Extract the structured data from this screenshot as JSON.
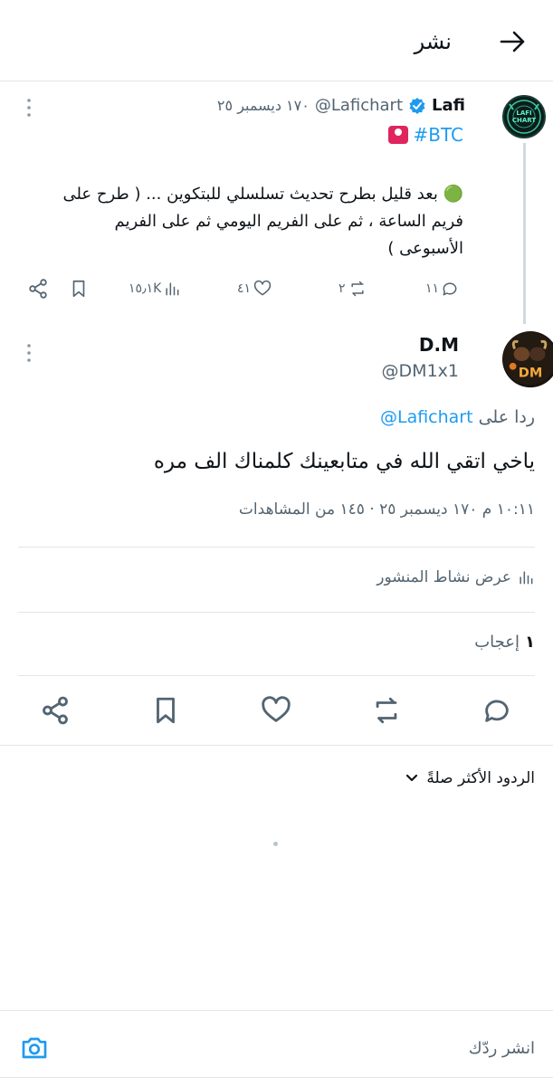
{
  "header": {
    "title": "نشر"
  },
  "parent_tweet": {
    "display_name": "Lafi",
    "handle": "@Lafichart",
    "date": "١٧٠ ديسمبر ٢٥",
    "hashtag": "#BTC",
    "text_line1": "🟢 بعد قليل بطرح تحديث تسلسلي للبتكوين ... ( طرح على",
    "text_line2": "فريم الساعة ، ثم على الفريم اليومي ثم على الفريم",
    "text_line3": "الأسبوعى )",
    "avatar_text": "LAFI CHART",
    "stats": {
      "replies": "١١",
      "reposts": "٢",
      "likes": "٤١",
      "views": "١٥٫١K"
    }
  },
  "reply_tweet": {
    "display_name": "D.M",
    "handle": "@DM1x1",
    "avatar_text": "DM",
    "replying_to_label": "ردا على",
    "replying_to_handle": "@Lafichart",
    "text": "ياخي اتقي الله في متابعينك  كلمناك الف مره",
    "meta": "١٠:١١ م ١٧٠ ديسمبر ٢٥ · ١٤٥ من المشاهدات"
  },
  "activity": {
    "label": "عرض نشاط المنشور"
  },
  "likes": {
    "count": "١",
    "label": "إعجاب"
  },
  "replies_sort": {
    "label": "الردود الأكثر صلةً"
  },
  "composer": {
    "placeholder": "انشر ردّك"
  },
  "colors": {
    "accent": "#1d9bf0",
    "muted": "#536471",
    "divider": "#e1e6ea"
  }
}
